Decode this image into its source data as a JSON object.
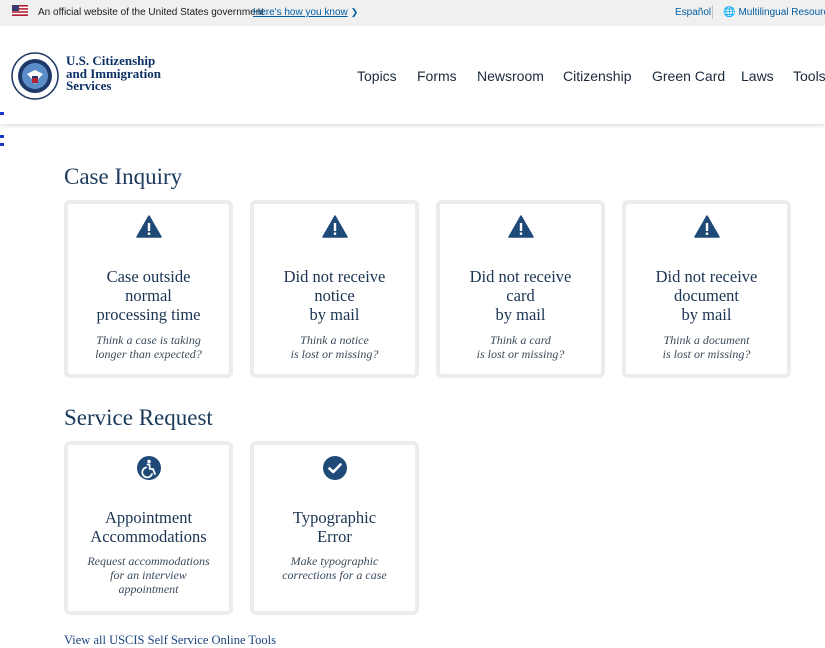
{
  "gov_banner": {
    "text": "An official website of the United States government",
    "link": "Here's how you know",
    "espanol": "Español",
    "multilingual": "Multilingual Resources"
  },
  "header": {
    "agency_line1": "U.S. Citizenship",
    "agency_line2": "and Immigration",
    "agency_line3": "Services",
    "nav": [
      "Topics",
      "Forms",
      "Newsroom",
      "Citizenship",
      "Green Card",
      "Laws",
      "Tools"
    ]
  },
  "case_inquiry": {
    "title": "Case Inquiry",
    "cards": [
      {
        "title": "Case outside\nnormal\nprocessing time",
        "desc": "Think a case is taking\nlonger than expected?",
        "icon": "warning-icon"
      },
      {
        "title": "Did not receive\nnotice\nby mail",
        "desc": "Think a notice\nis lost or missing?",
        "icon": "warning-icon"
      },
      {
        "title": "Did not receive\ncard\nby mail",
        "desc": "Think a card\nis lost or missing?",
        "icon": "warning-icon"
      },
      {
        "title": "Did not receive\ndocument\nby mail",
        "desc": "Think a document\nis lost or missing?",
        "icon": "warning-icon"
      }
    ]
  },
  "service_request": {
    "title": "Service Request",
    "cards": [
      {
        "title": "Appointment\nAccommodations",
        "desc": "Request accommodations\nfor an interview\nappointment",
        "icon": "accessibility-icon"
      },
      {
        "title": "Typographic\nError",
        "desc": "Make typographic\ncorrections for a case",
        "icon": "check-circle-icon"
      }
    ]
  },
  "view_all": "View all USCIS Self Service Online Tools",
  "colors": {
    "icon": "#1f4a78",
    "banner_bg": "#f0f0f0",
    "link": "#005ea2",
    "card_border": "#ececec"
  }
}
